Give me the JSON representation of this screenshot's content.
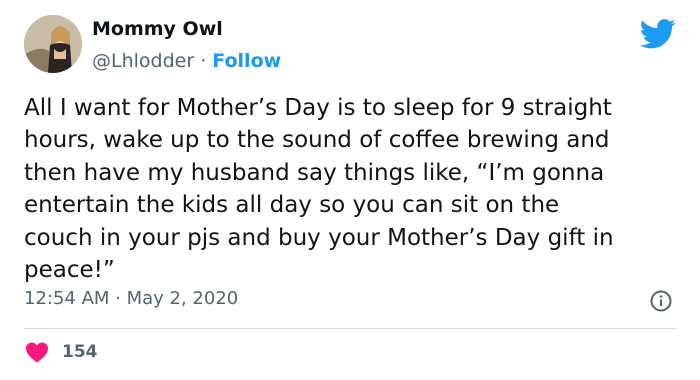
{
  "tweet": {
    "author_name": "Mommy Owl",
    "author_handle": "@Lhlodder",
    "separator": " · ",
    "follow_label": "Follow",
    "text_lines": [
      "All I want for Mother’s Day is to sleep for 9 straight",
      "hours, wake up to the sound of coffee brewing and",
      "then have my husband say things like, “I’m gonna",
      "entertain the kids all day so you can sit on the",
      "couch in your pjs and buy your Mother’s Day gift in",
      "peace!”"
    ],
    "timestamp": "12:54 AM · May 2, 2020",
    "like_count": "154"
  },
  "icons": {
    "logo": "twitter-bird-icon",
    "info": "info-icon",
    "like": "heart-icon"
  },
  "colors": {
    "brand_blue": "#1d9bf0",
    "like_red": "#f91880",
    "text": "#0f1419",
    "secondary_text": "#536471",
    "divider": "#cfd9de"
  }
}
